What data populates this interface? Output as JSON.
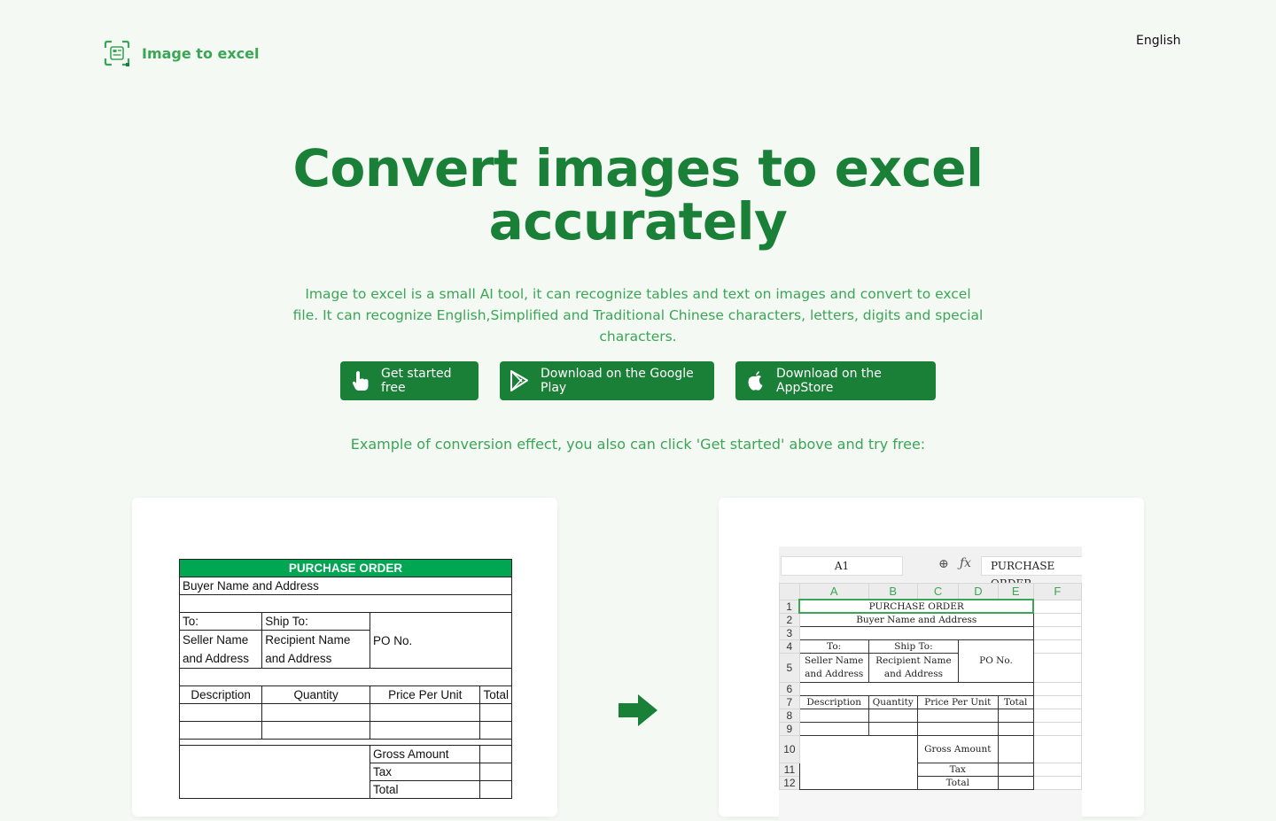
{
  "header": {
    "logo_text": "Image to excel",
    "language": "English"
  },
  "hero": {
    "title_line1": "Convert images to excel",
    "title_line2": "accurately",
    "subtitle": "Image to excel is a small AI tool, it can recognize tables and text on images and convert to excel file. It can recognize English,Simplified and Traditional Chinese characters, letters, digits and special characters."
  },
  "buttons": {
    "get_started": "Get started free",
    "google_play": "Download on the Google Play",
    "app_store": "Download on the AppStore"
  },
  "example_text": "Example of conversion effect, you also can click 'Get started' above and try free:",
  "colors": {
    "primary": "#1a7f37",
    "accent": "#3aa656",
    "background": "#f4f9f4",
    "po_header": "#00a651"
  },
  "source_image": {
    "title": "PURCHASE ORDER",
    "buyer": "Buyer Name and Address",
    "to": "To:",
    "ship_to": "Ship To:",
    "seller_1": "Seller Name",
    "seller_2": "and Address",
    "recipient_1": "Recipient Name",
    "recipient_2": "and Address",
    "po_no": "PO No.",
    "col_description": "Description",
    "col_quantity": "Quantity",
    "col_price": "Price Per Unit",
    "col_total": "Total",
    "gross": "Gross Amount",
    "tax": "Tax",
    "total": "Total"
  },
  "result_image": {
    "cell_ref": "A1",
    "formula_value": "PURCHASE ORDER",
    "columns": [
      "A",
      "B",
      "C",
      "D",
      "E",
      "F"
    ],
    "rows": [
      "1",
      "2",
      "3",
      "4",
      "5",
      "6",
      "7",
      "8",
      "9",
      "10",
      "11",
      "12"
    ],
    "title": "PURCHASE ORDER",
    "buyer": "Buyer Name and Address",
    "to": "To:",
    "ship_to": "Ship To:",
    "seller": "Seller Name and Address",
    "recipient": "Recipient Name and Address",
    "po_no": "PO No.",
    "col_description": "Description",
    "col_quantity": "Quantity",
    "col_price": "Price Per Unit",
    "col_total": "Total",
    "gross": "Gross Amount",
    "tax": "Tax",
    "total": "Total"
  }
}
